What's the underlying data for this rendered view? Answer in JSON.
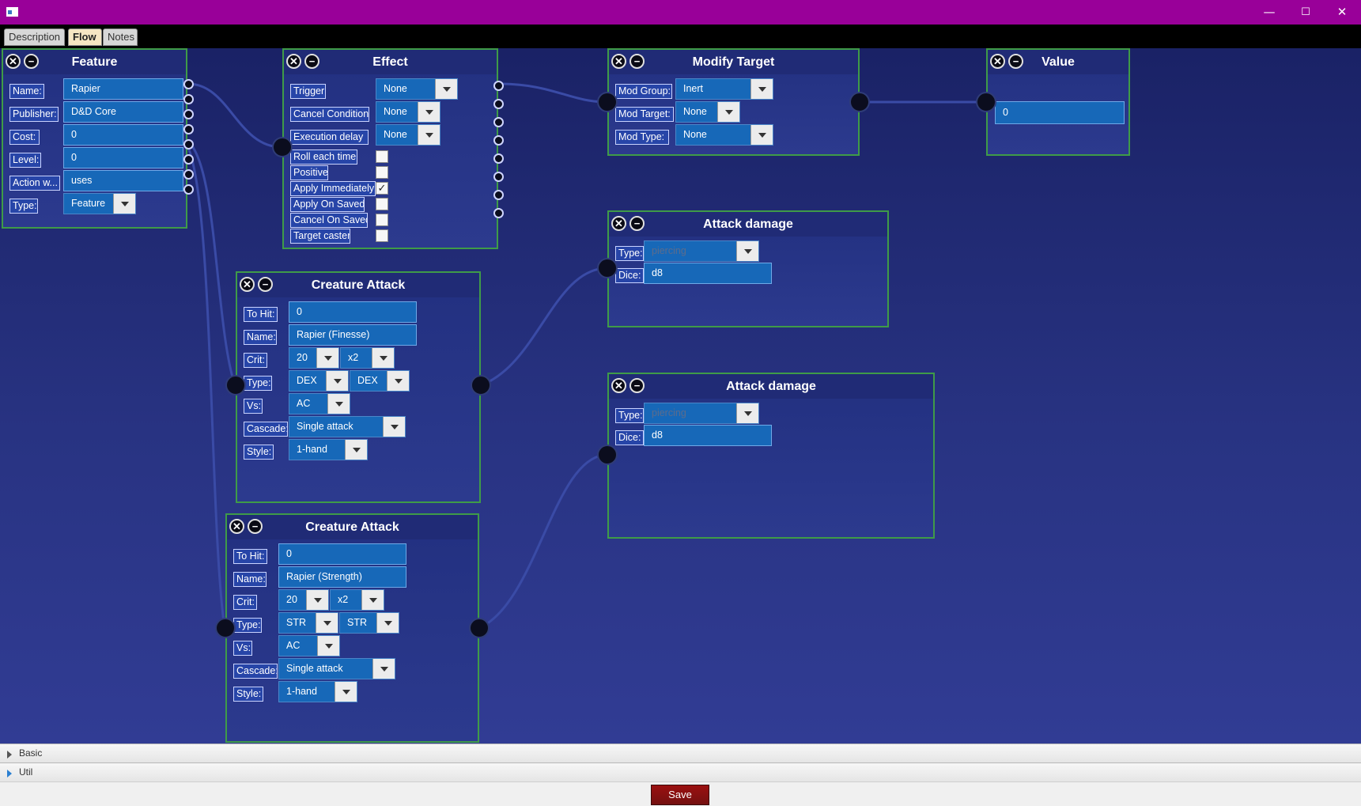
{
  "window": {
    "min": "—",
    "max": "☐",
    "close": "✕"
  },
  "tabs": [
    {
      "label": "Description"
    },
    {
      "label": "Flow"
    },
    {
      "label": "Notes"
    }
  ],
  "nodes": {
    "feature": {
      "title": "Feature",
      "name_label": "Name:",
      "name": "Rapier",
      "publisher_label": "Publisher:",
      "publisher": "D&D Core",
      "cost_label": "Cost:",
      "cost": "0",
      "level_label": "Level:",
      "level": "0",
      "action_label": "Action w...",
      "action": "uses",
      "type_label": "Type:",
      "type": "Feature"
    },
    "effect": {
      "title": "Effect",
      "trigger_label": "Trigger",
      "trigger": "None",
      "cancel_condition_label": "Cancel Condition",
      "cancel_condition": "None",
      "execution_delay_label": "Execution delay",
      "execution_delay": "None",
      "roll_each_time": "Roll each time",
      "positive": "Positive",
      "apply_immediately": "Apply Immediately",
      "apply_on_saved": "Apply On Saved",
      "cancel_on_saved": "Cancel On Saved",
      "target_caster": "Target caster",
      "check_mark": "✓"
    },
    "modify_target": {
      "title": "Modify Target",
      "mod_group_label": "Mod Group:",
      "mod_group": "Inert",
      "mod_target_label": "Mod Target:",
      "mod_target": "None",
      "mod_type_label": "Mod Type:",
      "mod_type": "None"
    },
    "value": {
      "title": "Value",
      "value": "0"
    },
    "attack_damage_1": {
      "title": "Attack damage",
      "type_label": "Type:",
      "type": "piercing",
      "dice_label": "Dice:",
      "dice": "d8"
    },
    "attack_damage_2": {
      "title": "Attack damage",
      "type_label": "Type:",
      "type": "piercing",
      "dice_label": "Dice:",
      "dice": "d8"
    },
    "creature_attack_1": {
      "title": "Creature Attack",
      "to_hit_label": "To Hit:",
      "to_hit": "0",
      "name_label": "Name:",
      "name": "Rapier (Finesse)",
      "crit_label": "Crit:",
      "crit_range": "20",
      "crit_mult": "x2",
      "type_label": "Type:",
      "type_a": "DEX",
      "type_b": "DEX",
      "vs_label": "Vs:",
      "vs": "AC",
      "cascade_label": "Cascade:",
      "cascade": "Single attack",
      "style_label": "Style:",
      "style": "1-hand"
    },
    "creature_attack_2": {
      "title": "Creature Attack",
      "to_hit_label": "To Hit:",
      "to_hit": "0",
      "name_label": "Name:",
      "name": "Rapier (Strength)",
      "crit_label": "Crit:",
      "crit_range": "20",
      "crit_mult": "x2",
      "type_label": "Type:",
      "type_a": "STR",
      "type_b": "STR",
      "vs_label": "Vs:",
      "vs": "AC",
      "cascade_label": "Cascade:",
      "cascade": "Single attack",
      "style_label": "Style:",
      "style": "1-hand"
    },
    "buttons": {
      "close": "✕",
      "collapse": "−"
    }
  },
  "panels": [
    {
      "label": "Basic"
    },
    {
      "label": "Util"
    }
  ],
  "save_label": "Save",
  "colors": {
    "titlebar": "#990099",
    "node_border": "#3f9b48",
    "field": "#1768b8",
    "save": "#8a1010"
  }
}
